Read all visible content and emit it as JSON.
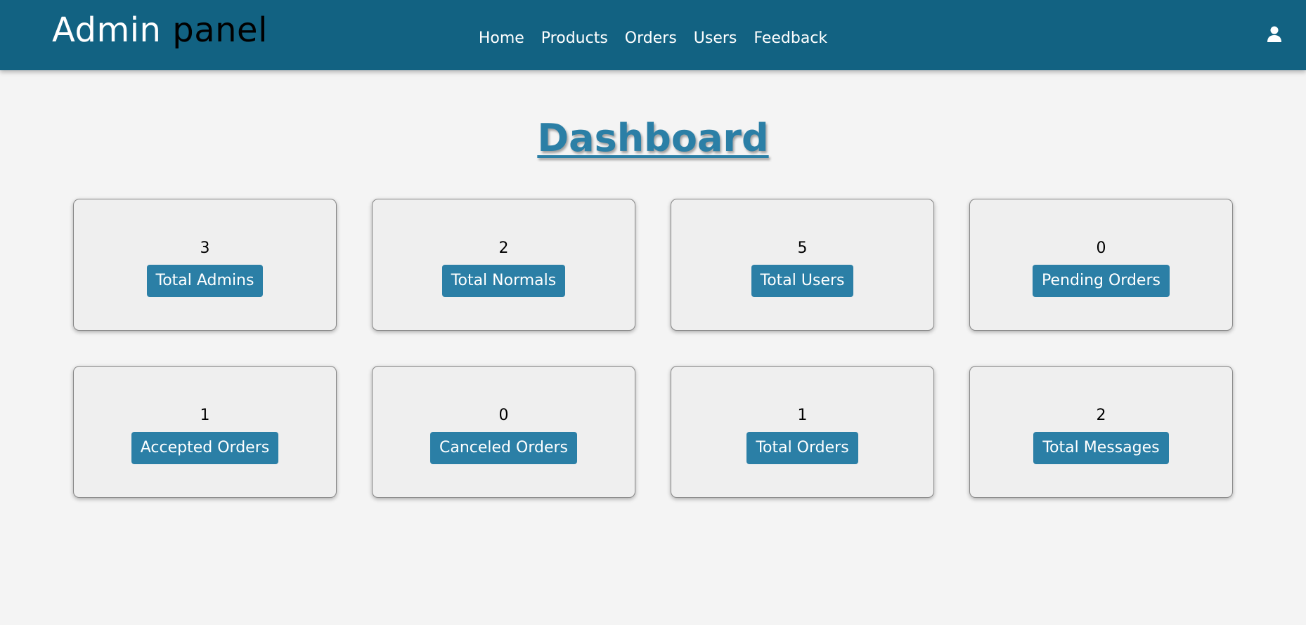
{
  "header": {
    "brand_part1": "Admin",
    "brand_part2": "panel",
    "nav": [
      {
        "label": "Home"
      },
      {
        "label": "Products"
      },
      {
        "label": "Orders"
      },
      {
        "label": "Users"
      },
      {
        "label": "Feedback"
      }
    ],
    "user_icon": "user-icon",
    "colors": {
      "header_bg": "#126282",
      "brand_secondary": "#000000"
    }
  },
  "page": {
    "title": "Dashboard",
    "accent": "#2b7fa6"
  },
  "cards": [
    {
      "value": "3",
      "label": "Total Admins"
    },
    {
      "value": "2",
      "label": "Total Normals"
    },
    {
      "value": "5",
      "label": "Total Users"
    },
    {
      "value": "0",
      "label": "Pending Orders"
    },
    {
      "value": "1",
      "label": "Accepted Orders"
    },
    {
      "value": "0",
      "label": "Canceled Orders"
    },
    {
      "value": "1",
      "label": "Total Orders"
    },
    {
      "value": "2",
      "label": "Total Messages"
    }
  ]
}
